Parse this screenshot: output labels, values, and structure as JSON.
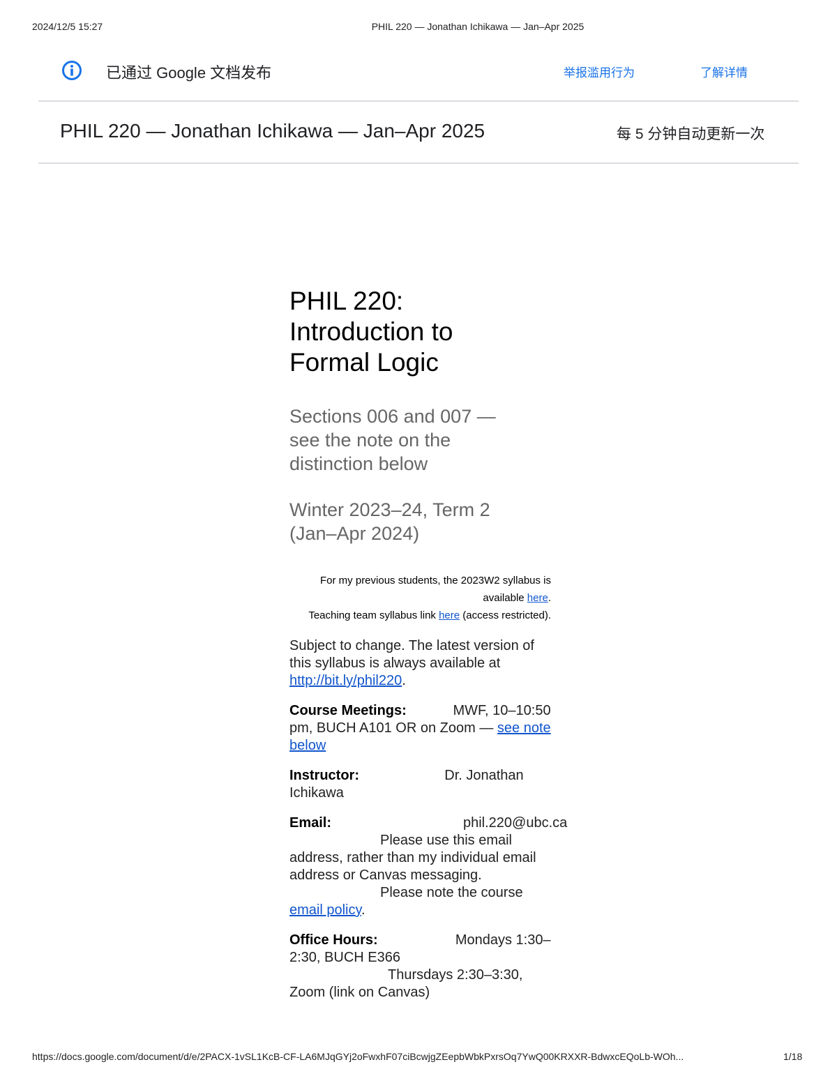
{
  "print_header": {
    "date": "2024/12/5 15:27",
    "title": "PHIL 220 — Jonathan Ichikawa — Jan–Apr 2025"
  },
  "publish_bar": {
    "icon": "info-icon",
    "published_text": "已通过 Google 文档发布",
    "report_link": "举报滥用行为",
    "learn_link": "了解详情"
  },
  "doc_header": {
    "title": "PHIL 220 — Jonathan Ichikawa — Jan–Apr 2025",
    "auto_update": "每 5 分钟自动更新一次"
  },
  "document": {
    "title_lines": [
      "PHIL 220:",
      "Introduction to",
      "Formal Logic"
    ],
    "subtitle_sections_lines": [
      "Sections 006 and 007 —",
      "see the note on the",
      "distinction below"
    ],
    "subtitle_term_lines": [
      "Winter 2023–24, Term 2",
      "(Jan–Apr 2024)"
    ],
    "note_previous": {
      "before": "For my previous students, the 2023W2 syllabus is available ",
      "link": "here",
      "after": "."
    },
    "note_team": {
      "before": "Teaching team syllabus link ",
      "link": "here",
      "after": " (access restricted)."
    },
    "subject_to_change": {
      "before": "Subject to change. The latest version of this syllabus is always available at ",
      "link": "http://bit.ly/phil220",
      "after": "."
    },
    "course_meetings": {
      "label": "Course Meetings:",
      "value": "MWF, 10–10:50 pm, BUCH A101 OR on Zoom — ",
      "link": "see note below"
    },
    "instructor": {
      "label": "Instructor:",
      "value": "Dr. Jonathan Ichikawa"
    },
    "email": {
      "label": "Email:",
      "address": "phil.220@ubc.ca",
      "note": "Please use this email address, rather than my individual email address or Canvas messaging.",
      "policy_before": "Please note the course ",
      "policy_link": "email policy",
      "policy_after": "."
    },
    "office_hours": {
      "label": "Office Hours:",
      "monday": "Mondays 1:30–2:30, BUCH E366",
      "thursday": "Thursdays 2:30–3:30, Zoom (link on Canvas)"
    }
  },
  "print_footer": {
    "url": "https://docs.google.com/document/d/e/2PACX-1vSL1KcB-CF-LA6MJqGYj2oFwxhF07ciBcwjgZEepbWbkPxrsOq7YwQ00KRXXR-BdwxcEQoLb-WOh...",
    "page": "1/18"
  },
  "colors": {
    "link": "#1155cc",
    "publish_link": "#1a73e8",
    "subtitle": "#666666",
    "divider": "#dadce0"
  }
}
